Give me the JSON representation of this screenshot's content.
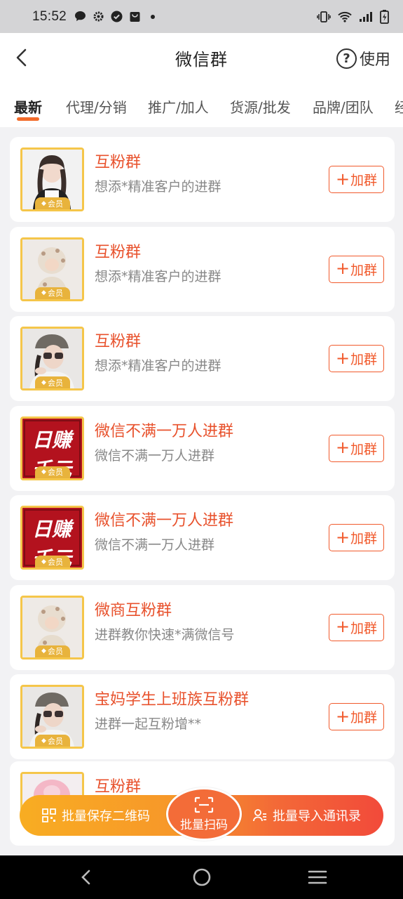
{
  "status_bar": {
    "time": "15:52"
  },
  "header": {
    "title": "微信群",
    "help_label": "使用"
  },
  "tabs": [
    {
      "label": "最新",
      "active": true
    },
    {
      "label": "代理/分销",
      "active": false
    },
    {
      "label": "推广/加人",
      "active": false
    },
    {
      "label": "货源/批发",
      "active": false
    },
    {
      "label": "品牌/团队",
      "active": false
    },
    {
      "label": "经",
      "active": false
    }
  ],
  "vip_label": "会员",
  "join_label": "加群",
  "groups": [
    {
      "title": "互粉群",
      "desc": "想添*精准客户的进群",
      "image": "girl-portrait"
    },
    {
      "title": "互粉群",
      "desc": "想添*精准客户的进群",
      "image": "baby-photo"
    },
    {
      "title": "互粉群",
      "desc": "想添*精准客户的进群",
      "image": "girl-glasses"
    },
    {
      "title": "微信不满一万人进群",
      "desc": "微信不满一万人进群",
      "image": "red-poster"
    },
    {
      "title": "微信不满一万人进群",
      "desc": "微信不满一万人进群",
      "image": "red-poster"
    },
    {
      "title": "微商互粉群",
      "desc": "进群教你快速*满微信号",
      "image": "baby-photo"
    },
    {
      "title": "宝妈学生上班族互粉群",
      "desc": "进群一起互粉增**",
      "image": "girl-glasses"
    }
  ],
  "poster_text": {
    "line1": "日赚",
    "line2": "千元"
  },
  "partial_group": {
    "title": "互粉群"
  },
  "bottom_bar": {
    "save_qr_label": "批量保存二维码",
    "scan_label": "批量扫码",
    "import_contacts_label": "批量导入通讯录"
  },
  "colors": {
    "accent": "#f26b2a",
    "title_red": "#e8522d",
    "vip_gold": "#e8b33c"
  }
}
